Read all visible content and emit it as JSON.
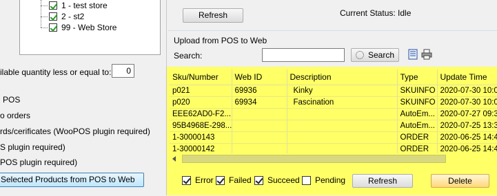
{
  "left": {
    "stores": [
      {
        "label": "1 - test store",
        "checked": true
      },
      {
        "label": "2 - st2",
        "checked": true
      },
      {
        "label": "99 - Web Store",
        "checked": true
      }
    ],
    "qty_label": "ilable quantity less or equal to:",
    "qty_value": "0",
    "options": [
      "POS",
      "o orders",
      "rds/cerificates (WooPOS plugin required)",
      "S plugin required)",
      "POS plugin required)"
    ],
    "upload_button": "Selected Products from POS to Web"
  },
  "top": {
    "refresh_label": "Refresh",
    "status_label": "Current Status: Idle"
  },
  "upload": {
    "title": "Upload from POS to Web",
    "search_label": "Search:",
    "search_value": "",
    "search_button": "Search",
    "icons": [
      "document-icon",
      "printer-icon"
    ]
  },
  "grid": {
    "columns": [
      "Sku/Number",
      "Web ID",
      "Description",
      "Type",
      "Update Time"
    ],
    "rows": [
      [
        "p021",
        "69936",
        "Kinky",
        "SKUINFO",
        "2020-07-30 10:0"
      ],
      [
        "p020",
        "69934",
        "Fascination",
        "SKUINFO",
        "2020-07-30 10:0"
      ],
      [
        "EEE62AD0-F2...",
        "",
        "",
        "AutoEm...",
        "2020-07-27 09:3"
      ],
      [
        "95B4968E-298...",
        "",
        "",
        "AutoEm...",
        "2020-07-25 13:3"
      ],
      [
        "1-30000143",
        "",
        "",
        "ORDER",
        "2020-06-25 14:4"
      ],
      [
        "1-30000142",
        "",
        "",
        "ORDER",
        "2020-06-25 14:4"
      ]
    ]
  },
  "filters": [
    {
      "label": "Error",
      "checked": true
    },
    {
      "label": "Failed",
      "checked": true
    },
    {
      "label": "Succeed",
      "checked": true
    },
    {
      "label": "Pending",
      "checked": false
    }
  ],
  "bottom": {
    "refresh_label": "Refresh",
    "delete_label": "Delete"
  },
  "colors": {
    "highlight": "#ffff66",
    "panel": "#f0f0f0"
  }
}
